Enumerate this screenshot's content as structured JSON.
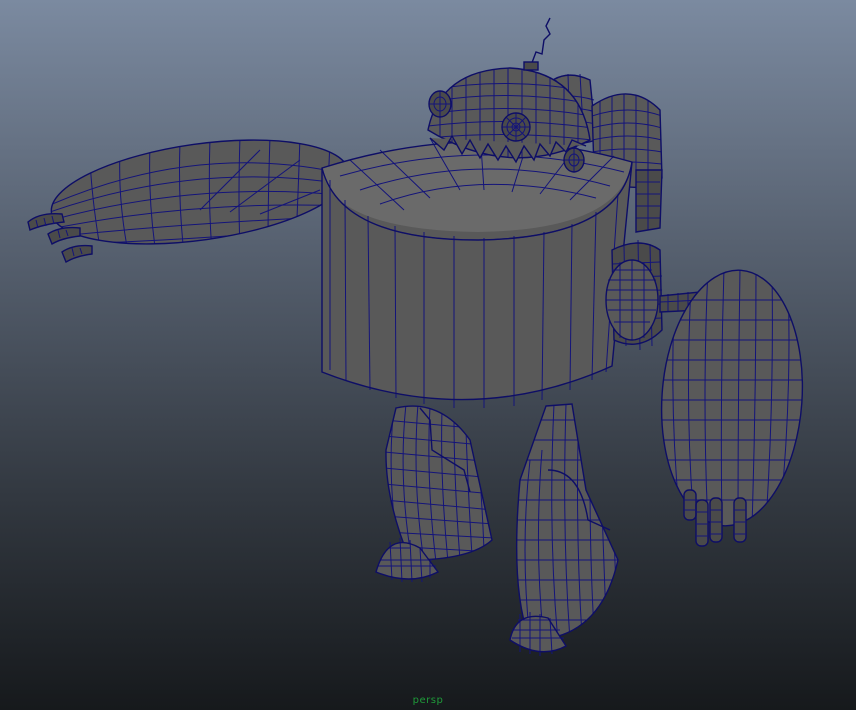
{
  "viewport": {
    "camera_label": "persp",
    "background_top": "#7b8aa0",
    "background_bottom": "#16191c",
    "wireframe_color": "#14147a",
    "shading_color": "#595959",
    "label_color": "#1f9a3a"
  },
  "scene": {
    "icons": {
      "model": "robot-model-icon"
    }
  }
}
